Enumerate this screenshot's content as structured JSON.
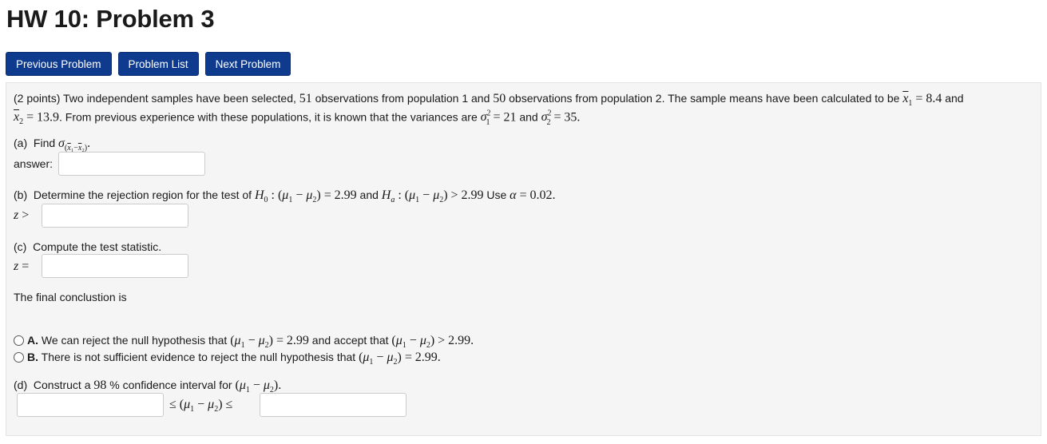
{
  "page": {
    "title": "HW 10: Problem 3"
  },
  "nav": {
    "previous": "Previous Problem",
    "list": "Problem List",
    "next": "Next Problem"
  },
  "problem": {
    "points": "(2 points)",
    "intro1": "Two independent samples have been selected,",
    "n1": "51",
    "intro2": "observations from population 1 and",
    "n2": "50",
    "intro3": "observations from population 2. The sample means have been calculated to be",
    "xbar1": "8.4",
    "and": "and",
    "xbar2": "13.9",
    "intro4": ". From previous experience with these populations, it is known that the variances are",
    "var1": "21",
    "var2": "35"
  },
  "part_a": {
    "label": "(a)",
    "text": "Find",
    "answer_label": "answer:",
    "answer_value": ""
  },
  "part_b": {
    "label": "(b)",
    "text1": "Determine the rejection region for the test of",
    "h0_value": "2.99",
    "and": "and",
    "ha_value": "2.99",
    "use": "Use",
    "alpha": "0.02",
    "answer_value": ""
  },
  "part_c": {
    "label": "(c)",
    "text": "Compute the test statistic.",
    "answer_value": ""
  },
  "conclusion": {
    "text": "The final conclustion is",
    "options": [
      {
        "letter": "A.",
        "text1": "We can reject the null hypothesis that",
        "val1": "2.99",
        "text2": "and accept that",
        "val2": "2.99."
      },
      {
        "letter": "B.",
        "text1": "There is not sufficient evidence to reject the null hypothesis that",
        "val1": "2.99."
      }
    ]
  },
  "part_d": {
    "label": "(d)",
    "text1": "Construct a",
    "conf": "98",
    "text2": "% confidence interval for",
    "lower_value": "",
    "upper_value": ""
  }
}
